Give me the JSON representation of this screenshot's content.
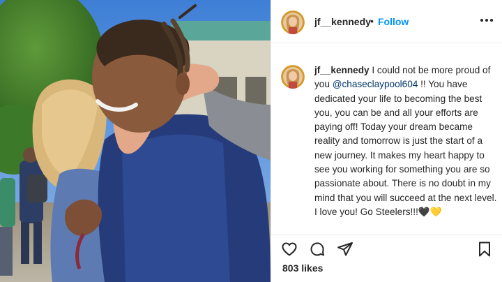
{
  "post": {
    "username": "jf__kennedy",
    "separator": "•",
    "follow_label": "Follow",
    "caption_username": "jf__kennedy",
    "caption_before": " I could not be more proud of you ",
    "caption_mention": "@chaseclaypool604",
    "caption_after": " !! You have dedicated your life to becoming the best you, you can be and all your efforts are paying off! Today your dream became reality and tomorrow is just the start of a new journey. It makes my heart happy to see you working for something you are so passionate about. There is no doubt in my mind that you will succeed at the next level. I love you! Go Steelers!!!🖤💛",
    "likes": "803 likes"
  },
  "icons": {
    "more": "more-options-icon",
    "like": "heart-icon",
    "comment": "comment-icon",
    "share": "share-icon",
    "save": "bookmark-icon"
  },
  "colors": {
    "accent": "#0095f6",
    "text": "#262626",
    "mention": "#00376b"
  }
}
